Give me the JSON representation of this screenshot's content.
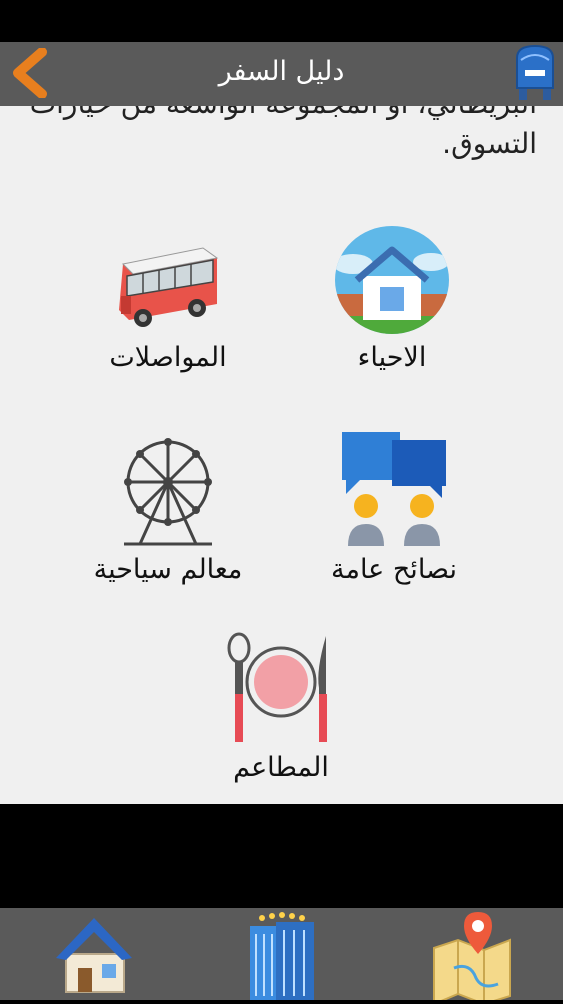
{
  "header": {
    "title": "دليل السفر"
  },
  "intro_text": "البريطاني، أو المجموعة الواسعة من خيارات التسوق.",
  "menu": [
    {
      "label": "الاحياء",
      "icon": "house-icon"
    },
    {
      "label": "المواصلات",
      "icon": "bus-icon"
    },
    {
      "label": "نصائح عامة",
      "icon": "chat-people-icon"
    },
    {
      "label": "معالم سياحية",
      "icon": "ferris-wheel-icon"
    },
    {
      "label": "المطاعم",
      "icon": "plate-cutlery-icon"
    }
  ],
  "bottom_nav": [
    {
      "icon": "home-icon"
    },
    {
      "icon": "hotel-icon"
    },
    {
      "icon": "map-pin-icon"
    }
  ]
}
